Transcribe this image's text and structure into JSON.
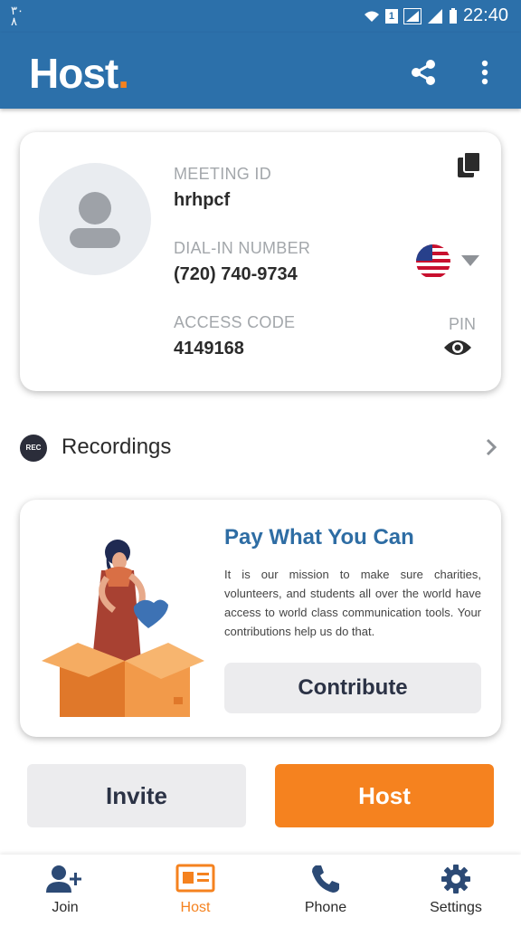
{
  "status_bar": {
    "left_text": "٣٠\n٨",
    "sim_badge": "1",
    "time": "22:40"
  },
  "app_bar": {
    "logo_text": "Host",
    "logo_dot": ".",
    "icons": [
      "share-icon",
      "more-vert-icon"
    ]
  },
  "meeting": {
    "meeting_id_label": "MEETING ID",
    "meeting_id": "hrhpcf",
    "dial_in_label": "DIAL-IN NUMBER",
    "dial_in": "(720) 740-9734",
    "access_code_label": "ACCESS CODE",
    "access_code": "4149168",
    "pin_label": "PIN",
    "icons": [
      "copy-icon",
      "us-flag-icon",
      "caret-down-icon",
      "eye-icon",
      "person-icon"
    ]
  },
  "recordings": {
    "badge": "REC",
    "label": "Recordings"
  },
  "pay": {
    "title": "Pay What You Can",
    "text": "It is our mission to make sure charities, volunteers, and students all over the world have access to world class communication tools. Your contributions help us do that.",
    "contribute_label": "Contribute"
  },
  "actions": {
    "invite_label": "Invite",
    "host_label": "Host"
  },
  "bottom_nav": {
    "items": [
      {
        "label": "Join",
        "icon": "add-person-icon"
      },
      {
        "label": "Host",
        "icon": "id-card-icon",
        "active": true
      },
      {
        "label": "Phone",
        "icon": "phone-icon"
      },
      {
        "label": "Settings",
        "icon": "gear-icon"
      }
    ]
  },
  "colors": {
    "primary": "#2c70aa",
    "accent": "#f5821f",
    "title_blue": "#2e6da4"
  }
}
